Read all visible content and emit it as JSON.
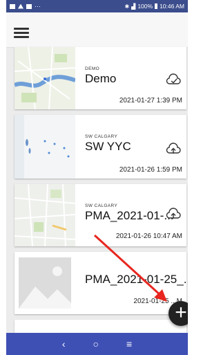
{
  "status_bar": {
    "time": "10:46 AM",
    "battery": "100%"
  },
  "app": {
    "menu_icon": "hamburger-menu-icon"
  },
  "projects": [
    {
      "subtitle": "DEMO",
      "title": "Demo",
      "date": "2021-01-27 1:39 PM",
      "sync_icon": "cloud-synced-icon"
    },
    {
      "subtitle": "SW CALGARY",
      "title": "SW YYC",
      "date": "2021-01-26 1:59 PM",
      "sync_icon": "cloud-upload-icon"
    },
    {
      "subtitle": "SW CALGARY",
      "title": "PMA_2021-01-...",
      "date": "2021-01-26 10:47 AM",
      "sync_icon": "cloud-upload-icon"
    },
    {
      "subtitle": "",
      "title": "PMA_2021-01-25_...",
      "date": "2021-01-25 ...M",
      "sync_icon": ""
    }
  ],
  "fab": {
    "label": "+",
    "icon": "add-icon"
  },
  "nav": {
    "back": "‹",
    "home": "○",
    "recents": "≡"
  },
  "colors": {
    "status_bar": "#3b4d8c",
    "nav_bar": "#3f50b5",
    "annotation_arrow": "#e8261f"
  }
}
